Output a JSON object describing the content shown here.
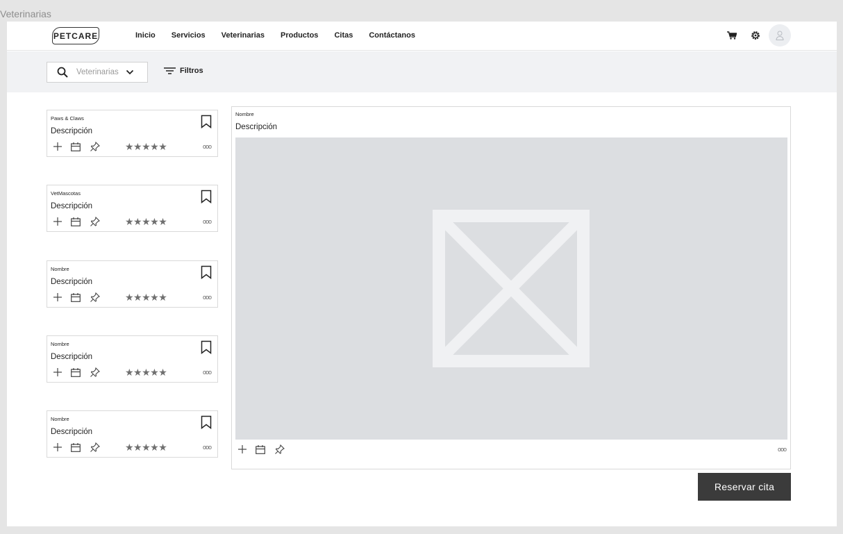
{
  "page": {
    "frame_title": "Veterinarias"
  },
  "header": {
    "logo_text": "PETCARE",
    "nav": [
      {
        "label": "Inicio"
      },
      {
        "label": "Servicios"
      },
      {
        "label": "Veterinarias"
      },
      {
        "label": "Productos"
      },
      {
        "label": "Citas"
      },
      {
        "label": "Contáctanos"
      }
    ],
    "icons": [
      "cart-icon",
      "gear-icon",
      "user-icon"
    ]
  },
  "filters": {
    "search_value": "Veterinarias",
    "filter_label": "Filtros"
  },
  "cards": [
    {
      "name": "Paws & Claws",
      "description": "Descripción",
      "rating_stars": "★★★★★",
      "more": "ooo"
    },
    {
      "name": "VetMascotas",
      "description": "Descripción",
      "rating_stars": "★★★★★",
      "more": "ooo"
    },
    {
      "name": "Nombre",
      "description": "Descripción",
      "rating_stars": "★★★★★",
      "more": "ooo"
    },
    {
      "name": "Nombre",
      "description": "Descripción",
      "rating_stars": "★★★★★",
      "more": "ooo"
    },
    {
      "name": "Nombre",
      "description": "Descripción",
      "rating_stars": "★★★★★",
      "more": "ooo"
    }
  ],
  "detail": {
    "name": "Nombre",
    "description": "Descripción",
    "more": "ooo"
  },
  "actions": {
    "reserve_label": "Reservar cita"
  },
  "colors": {
    "page_bg": "#e5e5e5",
    "filter_bar_bg": "#f1f2f4",
    "image_placeholder": "#dcdee1",
    "button_bg": "#3b3b3b",
    "star_color": "#6f6f6f"
  }
}
